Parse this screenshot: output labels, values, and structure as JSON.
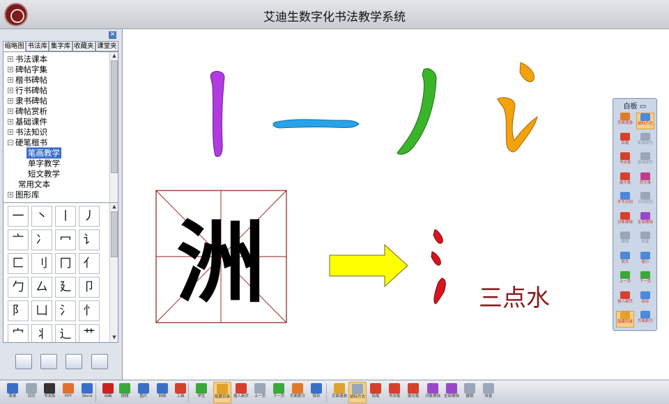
{
  "window": {
    "title": "艾迪生数字化书法教学系统"
  },
  "panel": {
    "tabs": [
      "缩略图",
      "书法库",
      "集字库",
      "收藏夹",
      "课堂夹"
    ],
    "tree": [
      "书法课本",
      "碑帖字集",
      "楷书碑帖",
      "行书碑帖",
      "隶书碑帖",
      "碑帖赏析",
      "基础课件",
      "书法知识",
      "硬笔楷书",
      "笔画教学",
      "单字教学",
      "短文教学",
      "常用文本",
      "图形库"
    ],
    "tree_selected": "笔画教学",
    "grid_chars": [
      "一",
      "丶",
      "丨",
      "丿",
      "亠",
      "冫",
      "冖",
      "讠",
      "匚",
      "刂",
      "冂",
      "亻",
      "勹",
      "厶",
      "廴",
      "卩",
      "阝",
      "凵",
      "氵",
      "忄",
      "宀",
      "丬",
      "辶",
      "艹"
    ]
  },
  "canvas": {
    "label_sandianshui": "三点水",
    "colors": {
      "purple": "#b13be0",
      "blue": "#27a3ea",
      "green": "#3ab52a",
      "orange": "#f2a20c",
      "yellow": "#ffff00",
      "red": "#d8151b",
      "darkred": "#8b1a1a",
      "grid": "#8b1a1a"
    }
  },
  "whiteboard": {
    "title": "白板",
    "buttons": [
      "页面漫游",
      "鼠标方式",
      "铅笔",
      "笔锋颜色",
      "书法笔",
      "笔锋颜色",
      "激光笔",
      "荧光笔",
      "手写识别",
      "识别颜色",
      "对象擦除",
      "全部擦除",
      "撤销",
      "恢复",
      "放大",
      "缩小",
      "上一页",
      "下一页",
      "插入新页",
      "保存",
      "隐藏目录",
      "页面索引"
    ]
  },
  "toolbar": {
    "items": [
      "菜单",
      "日历",
      "书法院",
      "PPT",
      "Word",
      "动画",
      "视频",
      "图片",
      "网络",
      "工具",
      "学生",
      "隐藏目录",
      "插入新页",
      "上一页",
      "下一页",
      "页面索引",
      "保存",
      "页面漫游",
      "鼠标方式",
      "铅笔",
      "书法笔",
      "激光笔",
      "对象擦除",
      "全部擦除",
      "撤销",
      "恢复"
    ]
  }
}
